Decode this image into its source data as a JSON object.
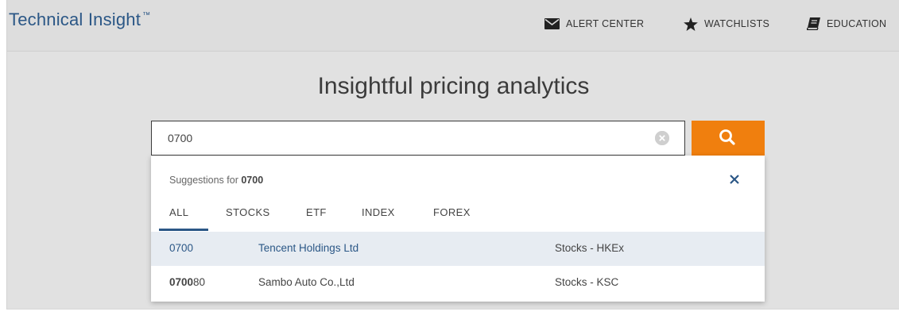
{
  "brand": {
    "title": "Technical Insight",
    "trademark": "™",
    "color": "#2b5786"
  },
  "nav": {
    "alert_center": {
      "label": "ALERT CENTER",
      "icon": "envelope-icon"
    },
    "watchlists": {
      "label": "WATCHLISTS",
      "icon": "star-icon"
    },
    "education": {
      "label": "EDUCATION",
      "icon": "book-icon"
    }
  },
  "main": {
    "headline": "Insightful pricing analytics"
  },
  "search": {
    "value": "0700",
    "placeholder": "",
    "clear_icon": "clear-circle-icon",
    "button_icon": "search-icon",
    "button_color": "#f07f0e"
  },
  "suggestions": {
    "label_prefix": "Suggestions for",
    "query": "0700",
    "close_icon": "close-icon",
    "tabs": [
      {
        "label": "ALL",
        "active": true
      },
      {
        "label": "STOCKS",
        "active": false
      },
      {
        "label": "ETF",
        "active": false
      },
      {
        "label": "INDEX",
        "active": false
      },
      {
        "label": "FOREX",
        "active": false
      }
    ],
    "results": [
      {
        "symbol_match": "0700",
        "symbol_rest": "",
        "name": "Tencent Holdings Ltd",
        "exchange": "Stocks - HKEx",
        "highlighted": true
      },
      {
        "symbol_match": "0700",
        "symbol_rest": "80",
        "name": "Sambo Auto Co.,Ltd",
        "exchange": "Stocks - KSC",
        "highlighted": false
      }
    ]
  }
}
